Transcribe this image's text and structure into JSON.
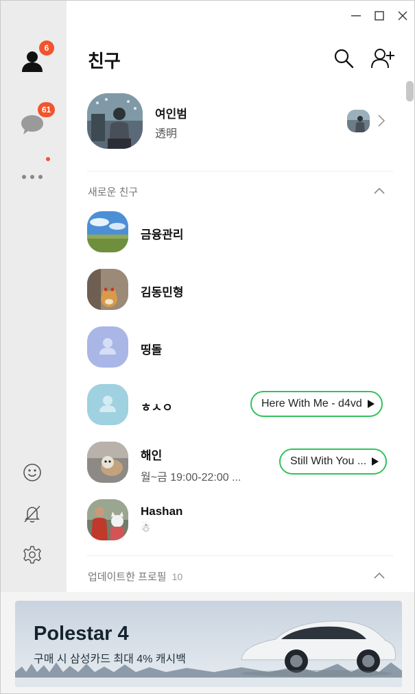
{
  "window": {
    "title": "친구",
    "controls": [
      "minimize-icon",
      "maximize-icon",
      "close-icon"
    ]
  },
  "rail": {
    "friends_badge": "6",
    "chats_badge": "61"
  },
  "me": {
    "name": "여인범",
    "status": "透明"
  },
  "sections": {
    "new_friends": {
      "title": "새로운 친구"
    },
    "updated": {
      "title": "업데이트한 프로필",
      "count": "10"
    }
  },
  "friends": [
    {
      "name": "금융관리"
    },
    {
      "name": "김동민형"
    },
    {
      "name": "띵돌"
    },
    {
      "name": "ㅎㅅㅇ",
      "music": "Here With Me - d4vd"
    },
    {
      "name": "해인",
      "status": "월~금 19:00-22:00 ...",
      "music": "Still With You ..."
    },
    {
      "name": "Hashan",
      "status": "☃"
    }
  ],
  "ad": {
    "title": "Polestar 4",
    "subtitle": "구매 시 삼성카드 최대 4% 캐시백"
  },
  "colors": {
    "accent_badge": "#f2542d",
    "music_border": "#2fc25b",
    "rail_bg": "#ececec"
  }
}
